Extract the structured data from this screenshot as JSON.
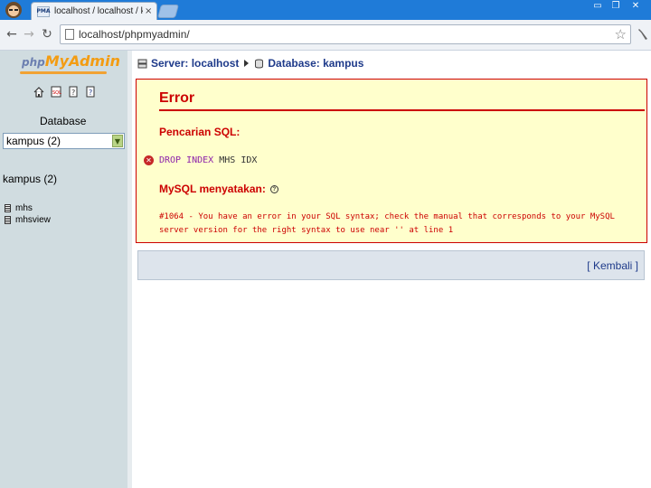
{
  "browser": {
    "tab_title": "localhost / localhost / kampus",
    "tab_close": "×",
    "favicon_text": "PMA",
    "url": "localhost/phpmyadmin/",
    "window_buttons": [
      "▭",
      "❐",
      "✕"
    ]
  },
  "sidebar": {
    "logo_php": "php",
    "logo_myadmin": "MyAdmin",
    "database_label": "Database",
    "database_select_value": "kampus (2)",
    "database_name": "kampus (2)",
    "tables": [
      {
        "name": "mhs"
      },
      {
        "name": "mhsview"
      }
    ]
  },
  "breadcrumb": {
    "server": "Server: localhost",
    "database": "Database: kampus"
  },
  "error": {
    "title": "Error",
    "sql_label": "Pencarian SQL:",
    "query_keyword": "DROP INDEX",
    "query_identifier": "MHS IDX",
    "mysql_label": "MySQL menyatakan:",
    "message": "#1064 - You have an error in your SQL syntax; check the manual that corresponds to your MySQL server version for the right syntax to use near '' at line 1"
  },
  "footer": {
    "back_link": "[ Kembali ]"
  },
  "colors": {
    "titlebar": "#1f7bd8",
    "error_red": "#cc0000",
    "error_bg": "#ffffcc",
    "sidebar_bg": "#d0dce0",
    "link_blue": "#1e3a8a"
  }
}
